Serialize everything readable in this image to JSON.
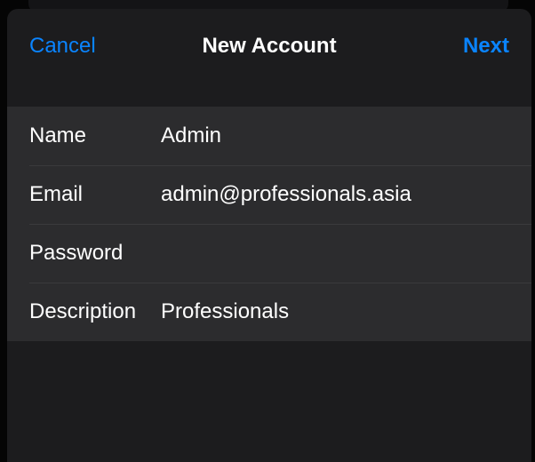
{
  "nav": {
    "cancel_label": "Cancel",
    "title": "New Account",
    "next_label": "Next"
  },
  "form": {
    "name": {
      "label": "Name",
      "value": "Admin"
    },
    "email": {
      "label": "Email",
      "value": "admin@professionals.asia"
    },
    "password": {
      "label": "Password",
      "value": ""
    },
    "description": {
      "label": "Description",
      "value": "Professionals"
    }
  },
  "colors": {
    "accent": "#0a84ff",
    "sheet_background": "#1c1c1e",
    "form_background": "#2c2c2e",
    "separator": "#3a3a3c",
    "text": "#ffffff"
  }
}
